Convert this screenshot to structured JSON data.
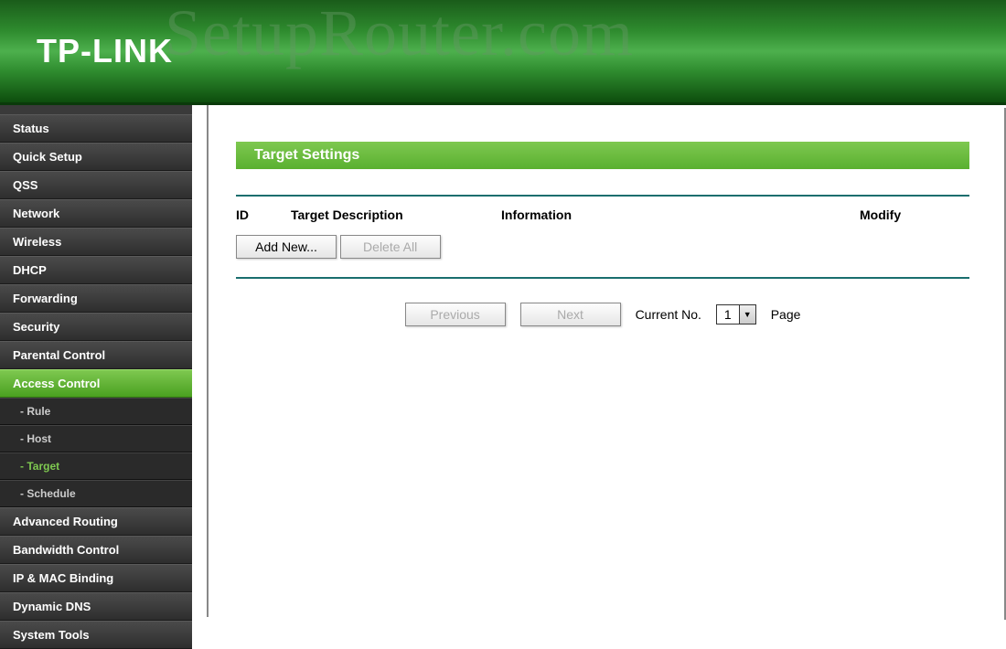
{
  "brand": {
    "logo": "TP-LINK"
  },
  "watermark": "SetupRouter.com",
  "sidebar": {
    "items": [
      {
        "label": "Status",
        "active": false
      },
      {
        "label": "Quick Setup",
        "active": false
      },
      {
        "label": "QSS",
        "active": false
      },
      {
        "label": "Network",
        "active": false
      },
      {
        "label": "Wireless",
        "active": false
      },
      {
        "label": "DHCP",
        "active": false
      },
      {
        "label": "Forwarding",
        "active": false
      },
      {
        "label": "Security",
        "active": false
      },
      {
        "label": "Parental Control",
        "active": false
      },
      {
        "label": "Access Control",
        "active": true,
        "subs": [
          {
            "label": "- Rule",
            "active": false
          },
          {
            "label": "- Host",
            "active": false
          },
          {
            "label": "- Target",
            "active": true
          },
          {
            "label": "- Schedule",
            "active": false
          }
        ]
      },
      {
        "label": "Advanced Routing",
        "active": false
      },
      {
        "label": "Bandwidth Control",
        "active": false
      },
      {
        "label": "IP & MAC Binding",
        "active": false
      },
      {
        "label": "Dynamic DNS",
        "active": false
      },
      {
        "label": "System Tools",
        "active": false
      }
    ]
  },
  "main": {
    "title": "Target Settings",
    "columns": {
      "id": "ID",
      "desc": "Target Description",
      "info": "Information",
      "mod": "Modify"
    },
    "buttons": {
      "add": "Add New...",
      "delete_all": "Delete All"
    },
    "pager": {
      "previous": "Previous",
      "next": "Next",
      "current_label": "Current No.",
      "current_value": "1",
      "page_label": "Page"
    }
  }
}
